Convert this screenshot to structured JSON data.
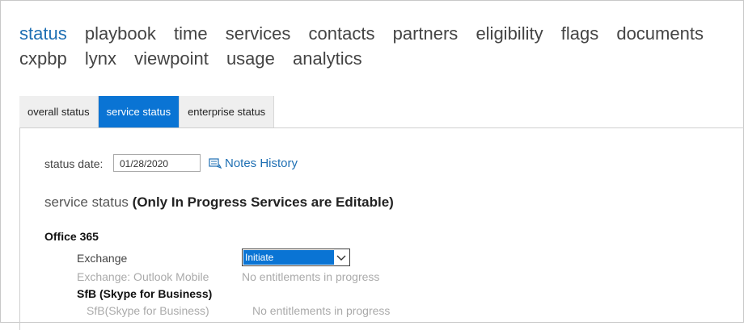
{
  "nav": {
    "items": [
      "status",
      "playbook",
      "time",
      "services",
      "contacts",
      "partners",
      "eligibility",
      "flags",
      "documents",
      "cxpbp",
      "lynx",
      "viewpoint",
      "usage",
      "analytics"
    ],
    "active": "status"
  },
  "tabs": [
    {
      "label": "overall status",
      "active": false
    },
    {
      "label": "service status",
      "active": true
    },
    {
      "label": "enterprise status",
      "active": false
    }
  ],
  "status_date": {
    "label": "status date:",
    "value": "01/28/2020"
  },
  "notes_history": {
    "label": "Notes History",
    "icon": "notes-icon"
  },
  "section": {
    "title": "service status",
    "note": "(Only In Progress Services are Editable)"
  },
  "office365": {
    "title": "Office 365",
    "exchange": {
      "label": "Exchange",
      "select_value": "Initiate"
    },
    "exchange_outlook": {
      "label": "Exchange: Outlook Mobile",
      "status": "No entitlements in progress"
    },
    "sfb": {
      "title": "SfB (Skype for Business)",
      "label": "SfB(Skype for Business)",
      "status": "No entitlements in progress"
    }
  },
  "colors": {
    "accent": "#0a74d4",
    "link": "#1e6fb3",
    "muted": "#aaaaaa"
  }
}
